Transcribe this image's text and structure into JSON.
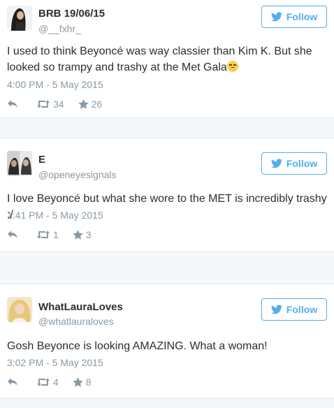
{
  "colors": {
    "accent": "#55acee",
    "muted": "#8899a6",
    "text": "#292f33",
    "divider": "#e1e8ed"
  },
  "follow_label": "Follow",
  "tweets": [
    {
      "name": "BRB 19/06/15",
      "handle": "@__fxhr_",
      "text": "I used to think Beyoncé was way classier than Kim K. But she looked so trampy and trashy at the Met Gala",
      "emoji": "unamused-face-emoji",
      "timestamp": "4:00 PM - 5 May 2015",
      "retweets": "34",
      "favorites": "26"
    },
    {
      "name": "E",
      "handle": "@openeyesignals",
      "text": "I love Beyoncé but what she wore to the MET is incredibly trashy :/",
      "timestamp": "1:41 PM - 5 May 2015",
      "retweets": "1",
      "favorites": "3"
    },
    {
      "name": "WhatLauraLoves",
      "handle": "@whatlauraloves",
      "text": "Gosh Beyonce is looking AMAZING. What a woman!",
      "timestamp": "3:02 PM - 5 May 2015",
      "retweets": "4",
      "favorites": "8"
    }
  ]
}
